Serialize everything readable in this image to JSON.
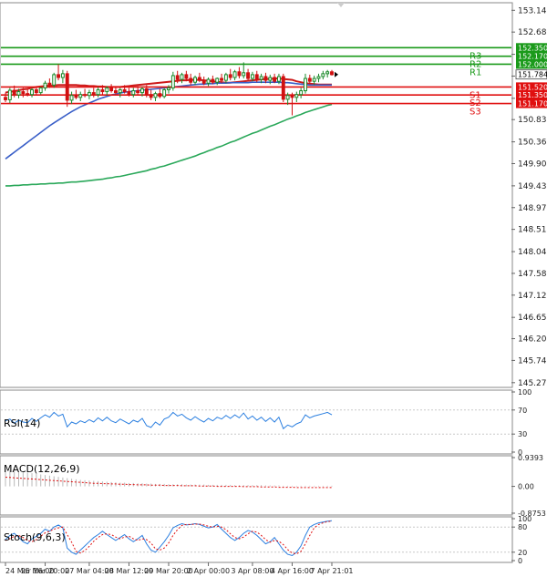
{
  "chart_data": {
    "type": "candlestick",
    "instrument_note": "",
    "price_axis": {
      "ticks": [
        153.14,
        152.68,
        152.21,
        151.75,
        151.28,
        150.83,
        150.36,
        149.9,
        149.43,
        148.97,
        148.51,
        148.04,
        147.58,
        147.12,
        146.65,
        146.2,
        145.74,
        145.27
      ],
      "ylim": [
        145.17,
        153.3
      ]
    },
    "x_axis": {
      "labels": [
        "24 Mar 16:00",
        "25 Mar 20:00",
        "27 Mar 04:00",
        "28 Mar 12:00",
        "29 Mar 20:00",
        "2 Apr 00:00",
        "3 Apr 08:00",
        "4 Apr 16:00",
        "7 Apr 21:01"
      ]
    },
    "levels": [
      {
        "name": "R3",
        "value": 152.35,
        "color": "#1a9a1a"
      },
      {
        "name": "R2",
        "value": 152.17,
        "color": "#1a9a1a"
      },
      {
        "name": "R1",
        "value": 152.0,
        "color": "#1a9a1a"
      },
      {
        "name": "S1",
        "value": 151.52,
        "color": "#e01010"
      },
      {
        "name": "S2",
        "value": 151.35,
        "color": "#e01010"
      },
      {
        "name": "S3",
        "value": 151.17,
        "color": "#e01010"
      }
    ],
    "current_price": {
      "value": 151.784,
      "label": "151.784"
    },
    "moving_averages": [
      {
        "color": "#cc1a1a",
        "values": [
          151.4,
          151.42,
          151.43,
          151.45,
          151.47,
          151.48,
          151.5,
          151.52,
          151.53,
          151.54,
          151.55,
          151.55,
          151.56,
          151.56,
          151.56,
          151.56,
          151.56,
          151.55,
          151.55,
          151.54,
          151.54,
          151.53,
          151.53,
          151.52,
          151.52,
          151.52,
          151.52,
          151.53,
          151.54,
          151.55,
          151.56,
          151.57,
          151.58,
          151.59,
          151.6,
          151.61,
          151.62,
          151.63,
          151.64,
          151.65,
          151.66,
          151.66,
          151.67,
          151.67,
          151.67,
          151.66,
          151.65,
          151.64,
          151.63,
          151.62,
          151.61,
          151.61,
          151.62,
          151.63,
          151.64,
          151.65,
          151.66,
          151.67,
          151.68,
          151.69,
          151.69,
          151.7,
          151.7,
          151.69,
          151.68,
          151.67,
          151.64,
          151.62,
          151.6,
          151.59,
          151.58,
          151.57,
          151.57,
          151.57,
          151.57
        ]
      },
      {
        "color": "#3a5fc8",
        "values": [
          150.0,
          150.07,
          150.14,
          150.21,
          150.28,
          150.35,
          150.42,
          150.49,
          150.56,
          150.63,
          150.7,
          150.76,
          150.82,
          150.88,
          150.94,
          151.0,
          151.05,
          151.1,
          151.14,
          151.18,
          151.22,
          151.26,
          151.29,
          151.32,
          151.35,
          151.37,
          151.39,
          151.41,
          151.42,
          151.43,
          151.44,
          151.45,
          151.46,
          151.47,
          151.48,
          151.49,
          151.5,
          151.51,
          151.52,
          151.53,
          151.54,
          151.55,
          151.56,
          151.57,
          151.58,
          151.58,
          151.59,
          151.59,
          151.6,
          151.6,
          151.6,
          151.61,
          151.61,
          151.61,
          151.61,
          151.61,
          151.62,
          151.62,
          151.62,
          151.62,
          151.62,
          151.62,
          151.62,
          151.61,
          151.61,
          151.6,
          151.59,
          151.58,
          151.57,
          151.56,
          151.56,
          151.56,
          151.56,
          151.56,
          151.56
        ]
      },
      {
        "color": "#2aa85a",
        "values": [
          149.43,
          149.43,
          149.44,
          149.44,
          149.45,
          149.45,
          149.46,
          149.46,
          149.47,
          149.47,
          149.48,
          149.48,
          149.49,
          149.49,
          149.5,
          149.51,
          149.51,
          149.52,
          149.53,
          149.54,
          149.55,
          149.56,
          149.57,
          149.59,
          149.6,
          149.62,
          149.63,
          149.65,
          149.67,
          149.69,
          149.71,
          149.73,
          149.75,
          149.78,
          149.8,
          149.83,
          149.85,
          149.88,
          149.91,
          149.94,
          149.97,
          150.0,
          150.03,
          150.06,
          150.1,
          150.13,
          150.17,
          150.2,
          150.24,
          150.27,
          150.31,
          150.35,
          150.38,
          150.42,
          150.46,
          150.5,
          150.54,
          150.57,
          150.61,
          150.65,
          150.69,
          150.72,
          150.76,
          150.8,
          150.84,
          150.87,
          150.91,
          150.94,
          150.98,
          151.01,
          151.04,
          151.07,
          151.1,
          151.13,
          151.15
        ]
      }
    ],
    "candles": [
      {
        "o": 151.3,
        "h": 151.4,
        "l": 151.2,
        "c": 151.25
      },
      {
        "o": 151.25,
        "h": 151.5,
        "l": 151.18,
        "c": 151.45
      },
      {
        "o": 151.45,
        "h": 151.55,
        "l": 151.3,
        "c": 151.35
      },
      {
        "o": 151.35,
        "h": 151.48,
        "l": 151.28,
        "c": 151.42
      },
      {
        "o": 151.42,
        "h": 151.5,
        "l": 151.3,
        "c": 151.38
      },
      {
        "o": 151.38,
        "h": 151.46,
        "l": 151.32,
        "c": 151.36
      },
      {
        "o": 151.36,
        "h": 151.5,
        "l": 151.3,
        "c": 151.46
      },
      {
        "o": 151.46,
        "h": 151.52,
        "l": 151.34,
        "c": 151.4
      },
      {
        "o": 151.4,
        "h": 151.52,
        "l": 151.36,
        "c": 151.5
      },
      {
        "o": 151.5,
        "h": 151.65,
        "l": 151.44,
        "c": 151.6
      },
      {
        "o": 151.6,
        "h": 151.7,
        "l": 151.5,
        "c": 151.56
      },
      {
        "o": 151.56,
        "h": 151.82,
        "l": 151.5,
        "c": 151.78
      },
      {
        "o": 151.78,
        "h": 152.0,
        "l": 151.66,
        "c": 151.72
      },
      {
        "o": 151.72,
        "h": 151.88,
        "l": 151.6,
        "c": 151.8
      },
      {
        "o": 151.8,
        "h": 151.86,
        "l": 151.1,
        "c": 151.24
      },
      {
        "o": 151.24,
        "h": 151.42,
        "l": 151.16,
        "c": 151.34
      },
      {
        "o": 151.34,
        "h": 151.46,
        "l": 151.26,
        "c": 151.3
      },
      {
        "o": 151.3,
        "h": 151.42,
        "l": 151.22,
        "c": 151.36
      },
      {
        "o": 151.36,
        "h": 151.48,
        "l": 151.3,
        "c": 151.34
      },
      {
        "o": 151.34,
        "h": 151.46,
        "l": 151.26,
        "c": 151.4
      },
      {
        "o": 151.4,
        "h": 151.5,
        "l": 151.3,
        "c": 151.36
      },
      {
        "o": 151.36,
        "h": 151.52,
        "l": 151.3,
        "c": 151.46
      },
      {
        "o": 151.46,
        "h": 151.56,
        "l": 151.36,
        "c": 151.42
      },
      {
        "o": 151.42,
        "h": 151.54,
        "l": 151.34,
        "c": 151.5
      },
      {
        "o": 151.5,
        "h": 151.58,
        "l": 151.4,
        "c": 151.44
      },
      {
        "o": 151.44,
        "h": 151.52,
        "l": 151.34,
        "c": 151.4
      },
      {
        "o": 151.4,
        "h": 151.5,
        "l": 151.3,
        "c": 151.46
      },
      {
        "o": 151.46,
        "h": 151.56,
        "l": 151.38,
        "c": 151.42
      },
      {
        "o": 151.42,
        "h": 151.5,
        "l": 151.32,
        "c": 151.36
      },
      {
        "o": 151.36,
        "h": 151.5,
        "l": 151.3,
        "c": 151.44
      },
      {
        "o": 151.44,
        "h": 151.54,
        "l": 151.36,
        "c": 151.4
      },
      {
        "o": 151.4,
        "h": 151.52,
        "l": 151.32,
        "c": 151.48
      },
      {
        "o": 151.48,
        "h": 151.56,
        "l": 151.3,
        "c": 151.36
      },
      {
        "o": 151.36,
        "h": 151.46,
        "l": 151.24,
        "c": 151.3
      },
      {
        "o": 151.3,
        "h": 151.42,
        "l": 151.22,
        "c": 151.38
      },
      {
        "o": 151.38,
        "h": 151.48,
        "l": 151.28,
        "c": 151.32
      },
      {
        "o": 151.32,
        "h": 151.5,
        "l": 151.28,
        "c": 151.46
      },
      {
        "o": 151.46,
        "h": 151.56,
        "l": 151.38,
        "c": 151.5
      },
      {
        "o": 151.5,
        "h": 151.84,
        "l": 151.44,
        "c": 151.76
      },
      {
        "o": 151.76,
        "h": 151.86,
        "l": 151.6,
        "c": 151.68
      },
      {
        "o": 151.68,
        "h": 151.82,
        "l": 151.6,
        "c": 151.78
      },
      {
        "o": 151.78,
        "h": 151.86,
        "l": 151.64,
        "c": 151.7
      },
      {
        "o": 151.7,
        "h": 151.8,
        "l": 151.56,
        "c": 151.62
      },
      {
        "o": 151.62,
        "h": 151.76,
        "l": 151.56,
        "c": 151.72
      },
      {
        "o": 151.72,
        "h": 151.82,
        "l": 151.62,
        "c": 151.66
      },
      {
        "o": 151.66,
        "h": 151.74,
        "l": 151.56,
        "c": 151.6
      },
      {
        "o": 151.6,
        "h": 151.72,
        "l": 151.54,
        "c": 151.68
      },
      {
        "o": 151.68,
        "h": 151.76,
        "l": 151.58,
        "c": 151.62
      },
      {
        "o": 151.62,
        "h": 151.72,
        "l": 151.56,
        "c": 151.7
      },
      {
        "o": 151.7,
        "h": 151.8,
        "l": 151.6,
        "c": 151.66
      },
      {
        "o": 151.66,
        "h": 151.82,
        "l": 151.6,
        "c": 151.78
      },
      {
        "o": 151.78,
        "h": 151.9,
        "l": 151.66,
        "c": 151.72
      },
      {
        "o": 151.72,
        "h": 151.88,
        "l": 151.66,
        "c": 151.84
      },
      {
        "o": 151.84,
        "h": 151.94,
        "l": 151.7,
        "c": 151.76
      },
      {
        "o": 151.76,
        "h": 152.04,
        "l": 151.7,
        "c": 151.82
      },
      {
        "o": 151.82,
        "h": 151.9,
        "l": 151.66,
        "c": 151.7
      },
      {
        "o": 151.7,
        "h": 151.84,
        "l": 151.64,
        "c": 151.78
      },
      {
        "o": 151.78,
        "h": 151.86,
        "l": 151.62,
        "c": 151.68
      },
      {
        "o": 151.68,
        "h": 151.8,
        "l": 151.6,
        "c": 151.74
      },
      {
        "o": 151.74,
        "h": 151.82,
        "l": 151.6,
        "c": 151.66
      },
      {
        "o": 151.66,
        "h": 151.78,
        "l": 151.58,
        "c": 151.72
      },
      {
        "o": 151.72,
        "h": 151.8,
        "l": 151.6,
        "c": 151.64
      },
      {
        "o": 151.64,
        "h": 151.8,
        "l": 151.58,
        "c": 151.74
      },
      {
        "o": 151.74,
        "h": 151.8,
        "l": 151.2,
        "c": 151.26
      },
      {
        "o": 151.26,
        "h": 151.4,
        "l": 151.14,
        "c": 151.34
      },
      {
        "o": 151.34,
        "h": 151.4,
        "l": 150.92,
        "c": 151.3
      },
      {
        "o": 151.3,
        "h": 151.42,
        "l": 151.2,
        "c": 151.36
      },
      {
        "o": 151.36,
        "h": 151.5,
        "l": 151.28,
        "c": 151.44
      },
      {
        "o": 151.44,
        "h": 151.8,
        "l": 151.38,
        "c": 151.7
      },
      {
        "o": 151.7,
        "h": 151.78,
        "l": 151.58,
        "c": 151.64
      },
      {
        "o": 151.64,
        "h": 151.76,
        "l": 151.56,
        "c": 151.7
      },
      {
        "o": 151.7,
        "h": 151.8,
        "l": 151.62,
        "c": 151.74
      },
      {
        "o": 151.74,
        "h": 151.86,
        "l": 151.68,
        "c": 151.8
      },
      {
        "o": 151.8,
        "h": 151.88,
        "l": 151.72,
        "c": 151.84
      },
      {
        "o": 151.84,
        "h": 151.88,
        "l": 151.76,
        "c": 151.78
      }
    ],
    "rsi": {
      "label": "RSI(14)",
      "ticks": [
        100,
        70,
        30,
        0
      ],
      "ylim": [
        0,
        100
      ],
      "values": [
        52,
        55,
        48,
        53,
        50,
        49,
        56,
        51,
        57,
        62,
        58,
        66,
        60,
        63,
        42,
        50,
        47,
        52,
        49,
        54,
        50,
        57,
        52,
        58,
        52,
        49,
        55,
        51,
        47,
        53,
        50,
        56,
        44,
        41,
        50,
        45,
        55,
        58,
        66,
        60,
        63,
        57,
        53,
        59,
        54,
        50,
        56,
        52,
        58,
        55,
        61,
        56,
        62,
        57,
        65,
        55,
        60,
        53,
        58,
        51,
        57,
        50,
        58,
        39,
        45,
        42,
        47,
        50,
        62,
        57,
        60,
        62,
        64,
        66,
        62
      ]
    },
    "macd": {
      "label": "MACD(12,26,9)",
      "ticks": [
        "0.9393",
        "0.00",
        "-0.8753"
      ],
      "ylim": [
        -0.8753,
        0.9393
      ],
      "histogram": [
        0.55,
        0.53,
        0.51,
        0.49,
        0.47,
        0.45,
        0.43,
        0.41,
        0.39,
        0.37,
        0.35,
        0.33,
        0.31,
        0.29,
        0.27,
        0.25,
        0.23,
        0.21,
        0.2,
        0.19,
        0.18,
        0.17,
        0.16,
        0.15,
        0.14,
        0.13,
        0.12,
        0.12,
        0.11,
        0.11,
        0.1,
        0.1,
        0.09,
        0.09,
        0.08,
        0.08,
        0.08,
        0.07,
        0.07,
        0.07,
        0.07,
        0.06,
        0.06,
        0.06,
        0.06,
        0.06,
        0.05,
        0.05,
        0.05,
        0.05,
        0.05,
        0.05,
        0.04,
        0.04,
        0.04,
        0.04,
        0.04,
        0.04,
        0.04,
        0.03,
        0.03,
        0.03,
        0.03,
        0.02,
        0.02,
        0.02,
        0.02,
        0.02,
        0.02,
        0.02,
        0.02,
        0.02,
        0.02,
        0.02,
        0.02
      ],
      "signal": [
        0.3,
        0.29,
        0.28,
        0.27,
        0.26,
        0.25,
        0.24,
        0.23,
        0.22,
        0.21,
        0.2,
        0.19,
        0.18,
        0.17,
        0.16,
        0.15,
        0.14,
        0.13,
        0.12,
        0.11,
        0.1,
        0.1,
        0.09,
        0.09,
        0.08,
        0.08,
        0.07,
        0.07,
        0.06,
        0.06,
        0.05,
        0.05,
        0.05,
        0.04,
        0.04,
        0.04,
        0.03,
        0.03,
        0.03,
        0.03,
        0.02,
        0.02,
        0.02,
        0.02,
        0.01,
        0.01,
        0.01,
        0.01,
        0.0,
        0.0,
        0.0,
        0.0,
        0.0,
        0.0,
        -0.01,
        -0.01,
        -0.01,
        -0.01,
        -0.02,
        -0.02,
        -0.02,
        -0.02,
        -0.03,
        -0.03,
        -0.03,
        -0.03,
        -0.04,
        -0.04,
        -0.04,
        -0.04,
        -0.04,
        -0.04,
        -0.04,
        -0.04,
        -0.04
      ]
    },
    "stoch": {
      "label": "Stoch(9,6,3)",
      "ticks": [
        100,
        80,
        20,
        0
      ],
      "ylim": [
        0,
        100
      ],
      "k": [
        50,
        60,
        65,
        55,
        45,
        40,
        52,
        58,
        65,
        75,
        70,
        80,
        85,
        78,
        30,
        20,
        15,
        25,
        35,
        45,
        55,
        62,
        70,
        62,
        55,
        48,
        55,
        62,
        52,
        45,
        52,
        60,
        40,
        25,
        20,
        32,
        45,
        60,
        78,
        84,
        88,
        85,
        86,
        88,
        86,
        82,
        78,
        80,
        86,
        75,
        65,
        55,
        48,
        55,
        65,
        72,
        68,
        60,
        50,
        40,
        45,
        55,
        40,
        25,
        15,
        12,
        20,
        35,
        60,
        80,
        86,
        90,
        92,
        94,
        95
      ],
      "d": [
        48,
        52,
        58,
        60,
        55,
        48,
        45,
        50,
        58,
        66,
        70,
        75,
        78,
        80,
        62,
        44,
        22,
        18,
        24,
        34,
        46,
        55,
        62,
        64,
        62,
        56,
        52,
        56,
        58,
        52,
        48,
        52,
        50,
        42,
        28,
        25,
        30,
        42,
        60,
        74,
        84,
        86,
        86,
        87,
        87,
        85,
        82,
        80,
        82,
        80,
        74,
        64,
        55,
        52,
        56,
        64,
        70,
        68,
        60,
        50,
        44,
        48,
        46,
        38,
        26,
        18,
        16,
        22,
        40,
        60,
        78,
        86,
        90,
        93,
        94
      ]
    }
  }
}
